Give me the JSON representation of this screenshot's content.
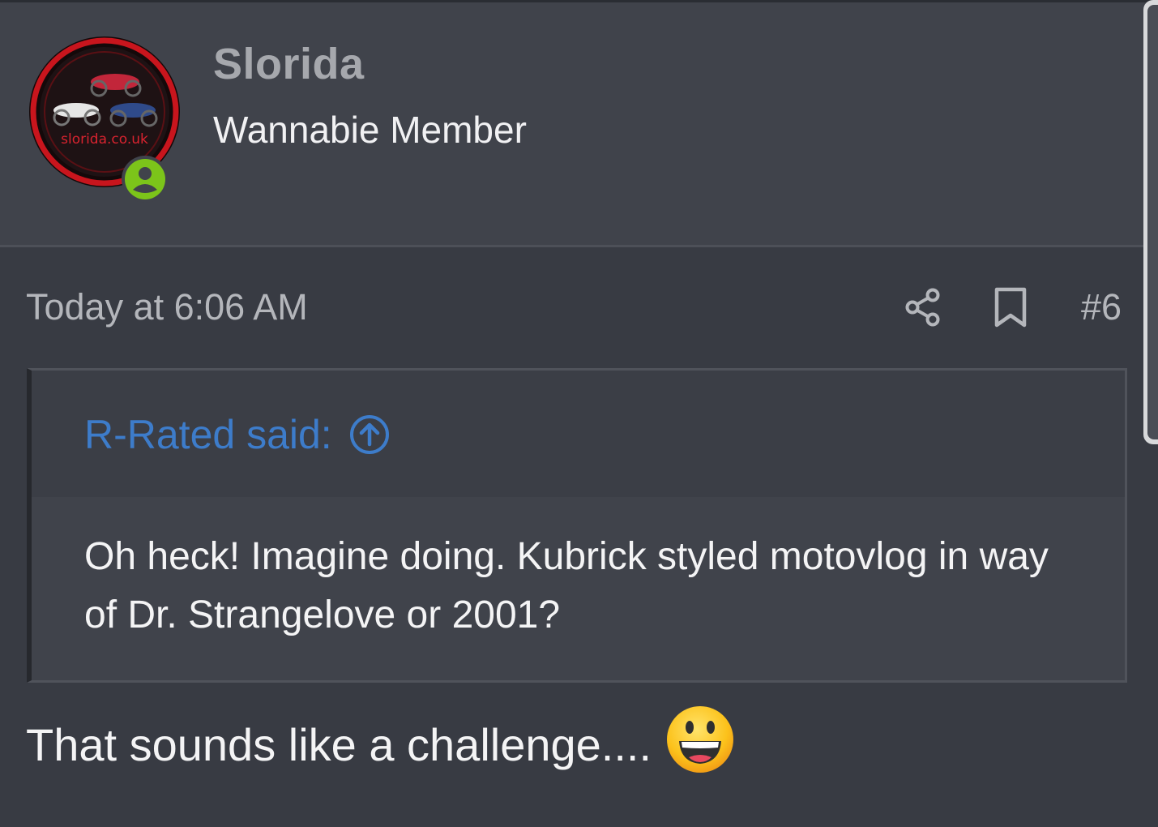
{
  "post": {
    "author": {
      "name": "Slorida",
      "title": "Wannabie Member",
      "avatar_text": "slorida.co.uk",
      "status": "online"
    },
    "date": "Today at 6:06 AM",
    "number": "#6",
    "quote": {
      "author_label": "R-Rated said:",
      "text": "Oh heck! Imagine doing. Kubrick styled motovlog in way of Dr. Strangelove or 2001?"
    },
    "body": "That sounds like a challenge....",
    "icons": {
      "share": "share-icon",
      "bookmark": "bookmark-icon",
      "quote_jump": "arrow-up-circle-icon",
      "emoji": "grinning-face-icon",
      "online": "user-online-icon"
    },
    "colors": {
      "accent": "#3d7cca",
      "online": "#7cc41a",
      "avatar_ring": "#c8151d"
    }
  }
}
